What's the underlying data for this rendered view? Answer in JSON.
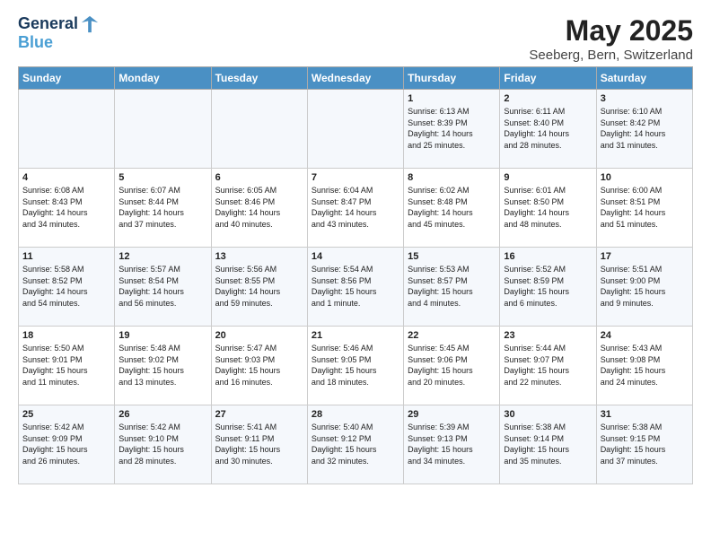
{
  "logo": {
    "line1": "General",
    "line2": "Blue"
  },
  "title": "May 2025",
  "subtitle": "Seeberg, Bern, Switzerland",
  "days_of_week": [
    "Sunday",
    "Monday",
    "Tuesday",
    "Wednesday",
    "Thursday",
    "Friday",
    "Saturday"
  ],
  "weeks": [
    [
      {
        "num": "",
        "info": ""
      },
      {
        "num": "",
        "info": ""
      },
      {
        "num": "",
        "info": ""
      },
      {
        "num": "",
        "info": ""
      },
      {
        "num": "1",
        "info": "Sunrise: 6:13 AM\nSunset: 8:39 PM\nDaylight: 14 hours\nand 25 minutes."
      },
      {
        "num": "2",
        "info": "Sunrise: 6:11 AM\nSunset: 8:40 PM\nDaylight: 14 hours\nand 28 minutes."
      },
      {
        "num": "3",
        "info": "Sunrise: 6:10 AM\nSunset: 8:42 PM\nDaylight: 14 hours\nand 31 minutes."
      }
    ],
    [
      {
        "num": "4",
        "info": "Sunrise: 6:08 AM\nSunset: 8:43 PM\nDaylight: 14 hours\nand 34 minutes."
      },
      {
        "num": "5",
        "info": "Sunrise: 6:07 AM\nSunset: 8:44 PM\nDaylight: 14 hours\nand 37 minutes."
      },
      {
        "num": "6",
        "info": "Sunrise: 6:05 AM\nSunset: 8:46 PM\nDaylight: 14 hours\nand 40 minutes."
      },
      {
        "num": "7",
        "info": "Sunrise: 6:04 AM\nSunset: 8:47 PM\nDaylight: 14 hours\nand 43 minutes."
      },
      {
        "num": "8",
        "info": "Sunrise: 6:02 AM\nSunset: 8:48 PM\nDaylight: 14 hours\nand 45 minutes."
      },
      {
        "num": "9",
        "info": "Sunrise: 6:01 AM\nSunset: 8:50 PM\nDaylight: 14 hours\nand 48 minutes."
      },
      {
        "num": "10",
        "info": "Sunrise: 6:00 AM\nSunset: 8:51 PM\nDaylight: 14 hours\nand 51 minutes."
      }
    ],
    [
      {
        "num": "11",
        "info": "Sunrise: 5:58 AM\nSunset: 8:52 PM\nDaylight: 14 hours\nand 54 minutes."
      },
      {
        "num": "12",
        "info": "Sunrise: 5:57 AM\nSunset: 8:54 PM\nDaylight: 14 hours\nand 56 minutes."
      },
      {
        "num": "13",
        "info": "Sunrise: 5:56 AM\nSunset: 8:55 PM\nDaylight: 14 hours\nand 59 minutes."
      },
      {
        "num": "14",
        "info": "Sunrise: 5:54 AM\nSunset: 8:56 PM\nDaylight: 15 hours\nand 1 minute."
      },
      {
        "num": "15",
        "info": "Sunrise: 5:53 AM\nSunset: 8:57 PM\nDaylight: 15 hours\nand 4 minutes."
      },
      {
        "num": "16",
        "info": "Sunrise: 5:52 AM\nSunset: 8:59 PM\nDaylight: 15 hours\nand 6 minutes."
      },
      {
        "num": "17",
        "info": "Sunrise: 5:51 AM\nSunset: 9:00 PM\nDaylight: 15 hours\nand 9 minutes."
      }
    ],
    [
      {
        "num": "18",
        "info": "Sunrise: 5:50 AM\nSunset: 9:01 PM\nDaylight: 15 hours\nand 11 minutes."
      },
      {
        "num": "19",
        "info": "Sunrise: 5:48 AM\nSunset: 9:02 PM\nDaylight: 15 hours\nand 13 minutes."
      },
      {
        "num": "20",
        "info": "Sunrise: 5:47 AM\nSunset: 9:03 PM\nDaylight: 15 hours\nand 16 minutes."
      },
      {
        "num": "21",
        "info": "Sunrise: 5:46 AM\nSunset: 9:05 PM\nDaylight: 15 hours\nand 18 minutes."
      },
      {
        "num": "22",
        "info": "Sunrise: 5:45 AM\nSunset: 9:06 PM\nDaylight: 15 hours\nand 20 minutes."
      },
      {
        "num": "23",
        "info": "Sunrise: 5:44 AM\nSunset: 9:07 PM\nDaylight: 15 hours\nand 22 minutes."
      },
      {
        "num": "24",
        "info": "Sunrise: 5:43 AM\nSunset: 9:08 PM\nDaylight: 15 hours\nand 24 minutes."
      }
    ],
    [
      {
        "num": "25",
        "info": "Sunrise: 5:42 AM\nSunset: 9:09 PM\nDaylight: 15 hours\nand 26 minutes."
      },
      {
        "num": "26",
        "info": "Sunrise: 5:42 AM\nSunset: 9:10 PM\nDaylight: 15 hours\nand 28 minutes."
      },
      {
        "num": "27",
        "info": "Sunrise: 5:41 AM\nSunset: 9:11 PM\nDaylight: 15 hours\nand 30 minutes."
      },
      {
        "num": "28",
        "info": "Sunrise: 5:40 AM\nSunset: 9:12 PM\nDaylight: 15 hours\nand 32 minutes."
      },
      {
        "num": "29",
        "info": "Sunrise: 5:39 AM\nSunset: 9:13 PM\nDaylight: 15 hours\nand 34 minutes."
      },
      {
        "num": "30",
        "info": "Sunrise: 5:38 AM\nSunset: 9:14 PM\nDaylight: 15 hours\nand 35 minutes."
      },
      {
        "num": "31",
        "info": "Sunrise: 5:38 AM\nSunset: 9:15 PM\nDaylight: 15 hours\nand 37 minutes."
      }
    ]
  ]
}
